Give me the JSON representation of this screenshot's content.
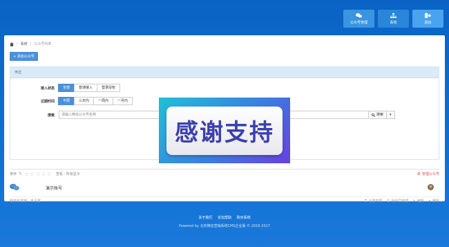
{
  "nav": [
    {
      "label": "公众号管理",
      "icon": "chat-bubbles-icon"
    },
    {
      "label": "系统",
      "icon": "sitemap-icon"
    },
    {
      "label": "退出",
      "icon": "logout-icon"
    }
  ],
  "breadcrumb": {
    "items": [
      "系统",
      "公众号列表"
    ]
  },
  "add_button": "+ 添加公众号",
  "filter": {
    "title": "筛选",
    "access_label": "接入状态",
    "access_options": [
      "全部",
      "普通接入",
      "登录授权"
    ],
    "expire_label": "过期时间",
    "expire_options": [
      "不限",
      "三天内",
      "一周内",
      "一月内"
    ],
    "search_label": "搜索",
    "search_placeholder": "请输入微信公众号名称",
    "search_button": "搜索"
  },
  "list_header": {
    "sort_label": "排序",
    "view_label": "查看 : 所有显示",
    "manage_label": "管理公众号"
  },
  "account": {
    "name": "演示账号"
  },
  "account_footer": {
    "left": "服务有效期 : 未设置",
    "actions": [
      "设置权限",
      "操作员管理",
      "编辑",
      "删除"
    ]
  },
  "footer": {
    "links": [
      "关于我们",
      "论坛帮助",
      "购买系统"
    ],
    "copyright": "Powered by 北校微信营销系统CMS企业版 © 2016-2017"
  },
  "overlay_text": "感谢支持"
}
